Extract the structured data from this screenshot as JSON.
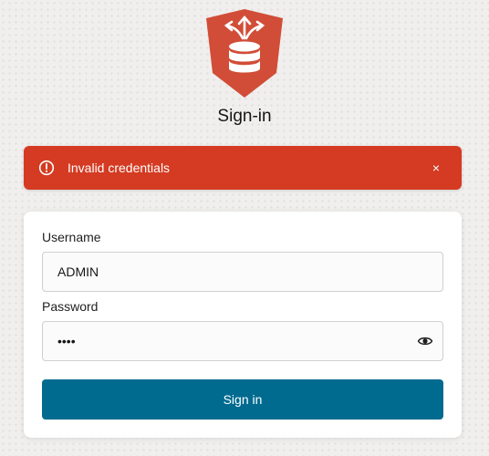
{
  "page": {
    "title": "Sign-in"
  },
  "logo": {
    "icon": "database-with-arrows-icon",
    "color": "#d14d37"
  },
  "alert": {
    "icon": "alert-circle-icon",
    "message": "Invalid credentials",
    "close_icon": "close-icon",
    "close_glyph": "×",
    "color": "#d43b22"
  },
  "form": {
    "username_label": "Username",
    "username_value": "ADMIN",
    "password_label": "Password",
    "password_value": "••••",
    "show_password_icon": "eye-icon",
    "submit_label": "Sign in",
    "button_color": "#006b8f"
  }
}
